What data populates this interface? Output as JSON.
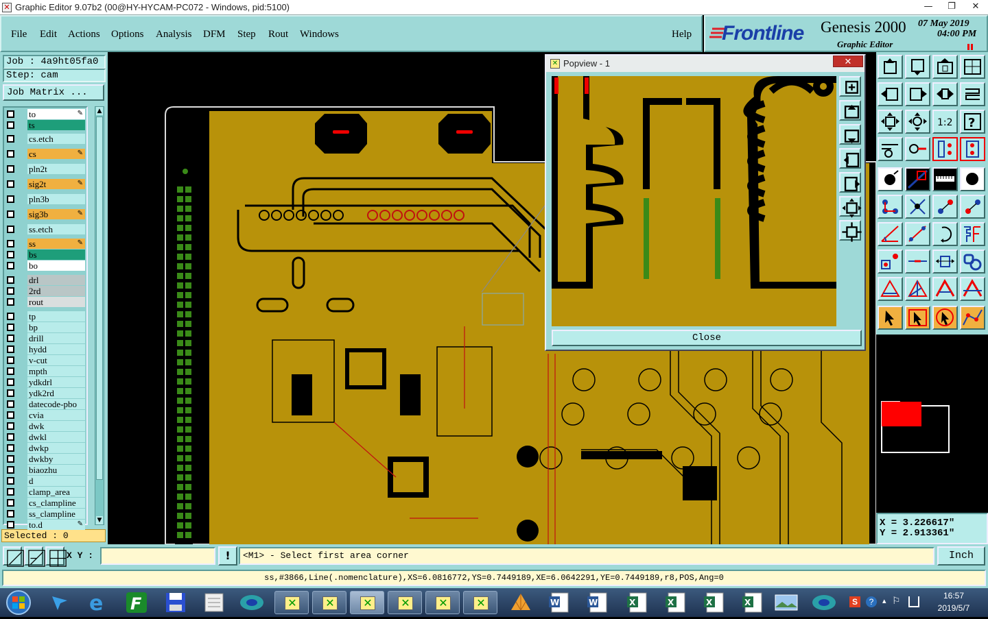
{
  "window": {
    "title": "Graphic Editor 9.07b2 (00@HY-HYCAM-PC072 - Windows, pid:5100)",
    "icon": "x-app-icon"
  },
  "menu": [
    "File",
    "Edit",
    "Actions",
    "Options",
    "Analysis",
    "DFM",
    "Step",
    "Rout",
    "Windows"
  ],
  "help": "Help",
  "logo": {
    "brand": "Frontline",
    "product": "Genesis 2000",
    "subtitle": "Graphic Editor",
    "date": "07 May 2019",
    "time": "04:00 PM"
  },
  "job": {
    "job_line": "Job : 4a9ht05fa0",
    "step_line": "Step: cam",
    "matrix_button": "Job Matrix ..."
  },
  "layers": [
    {
      "name": "to",
      "color": "#ffffff",
      "marker": true
    },
    {
      "name": "ts",
      "color": "#1e9e7a",
      "marker": false
    },
    {
      "name": "cs.etch",
      "color": "#b8ecea",
      "marker": false
    },
    {
      "name": "cs",
      "color": "#f0b040",
      "marker": true
    },
    {
      "name": "pln2t",
      "color": "#b8ecea",
      "marker": false
    },
    {
      "name": "sig2t",
      "color": "#f0b040",
      "marker": true
    },
    {
      "name": "pln3b",
      "color": "#b8ecea",
      "marker": false
    },
    {
      "name": "sig3b",
      "color": "#f0b040",
      "marker": true
    },
    {
      "name": "ss.etch",
      "color": "#b8ecea",
      "marker": false
    },
    {
      "name": "ss",
      "color": "#f0b040",
      "marker": true
    },
    {
      "name": "bs",
      "color": "#1e9e7a",
      "marker": false
    },
    {
      "name": "bo",
      "color": "#ffffff",
      "marker": false
    },
    {
      "name": "drl",
      "color": "#b9c6c6",
      "marker": false
    },
    {
      "name": "2rd",
      "color": "#b9c6c6",
      "marker": false
    },
    {
      "name": "rout",
      "color": "#d9dede",
      "marker": false
    },
    {
      "name": "tp",
      "color": "#b8ecea",
      "marker": false
    },
    {
      "name": "bp",
      "color": "#b8ecea",
      "marker": false
    },
    {
      "name": "drill",
      "color": "#b8ecea",
      "marker": false
    },
    {
      "name": "hydd",
      "color": "#b8ecea",
      "marker": false
    },
    {
      "name": "v-cut",
      "color": "#b8ecea",
      "marker": false
    },
    {
      "name": "mpth",
      "color": "#b8ecea",
      "marker": false
    },
    {
      "name": "ydkdrl",
      "color": "#b8ecea",
      "marker": false
    },
    {
      "name": "ydk2rd",
      "color": "#b8ecea",
      "marker": false
    },
    {
      "name": "datecode-pbo",
      "color": "#b8ecea",
      "marker": false
    },
    {
      "name": "cvia",
      "color": "#b8ecea",
      "marker": false
    },
    {
      "name": "dwk",
      "color": "#b8ecea",
      "marker": false
    },
    {
      "name": "dwkl",
      "color": "#b8ecea",
      "marker": false
    },
    {
      "name": "dwkp",
      "color": "#b8ecea",
      "marker": false
    },
    {
      "name": "dwkby",
      "color": "#b8ecea",
      "marker": false
    },
    {
      "name": "biaozhu",
      "color": "#b8ecea",
      "marker": false
    },
    {
      "name": "d",
      "color": "#b8ecea",
      "marker": false
    },
    {
      "name": "clamp_area",
      "color": "#b8ecea",
      "marker": false
    },
    {
      "name": "cs_clampline",
      "color": "#b8ecea",
      "marker": false
    },
    {
      "name": "ss_clampline",
      "color": "#b8ecea",
      "marker": false
    },
    {
      "name": "to.d",
      "color": "#b8ecea",
      "marker": true
    }
  ],
  "selected": "Selected : 0",
  "popview": {
    "title": "Popview - 1",
    "close": "Close"
  },
  "coords": {
    "x": "X = 3.226617\"",
    "y": "Y = 2.913361\""
  },
  "status": {
    "xy_label": "X Y :",
    "xy_value": "",
    "prompt": "<M1> - Select first area corner",
    "units": "Inch",
    "info": "ss,#3866,Line(.nomenclature),XS=6.0816772,YS=0.7449189,XE=6.0642291,YE=0.7449189,r8,POS,Ang=0"
  },
  "taskbar": {
    "time": "16:57",
    "date": "2019/5/7"
  },
  "colors": {
    "board": "#b8920a",
    "panel": "#9ed9d7",
    "field": "#b8ecea"
  }
}
